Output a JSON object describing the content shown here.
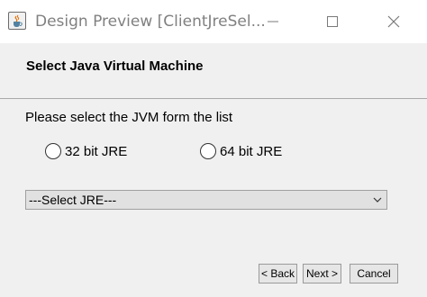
{
  "window": {
    "title": "Design Preview [ClientJreSel...",
    "app_icon": "java-cup-icon",
    "controls": [
      "minimize-icon",
      "maximize-icon",
      "close-icon"
    ]
  },
  "header": {
    "title": "Select Java Virtual Machine"
  },
  "content": {
    "prompt": "Please select the JVM form the list",
    "radios": [
      {
        "label": "32 bit JRE",
        "checked": false
      },
      {
        "label": "64 bit JRE",
        "checked": false
      }
    ],
    "select": {
      "value": "---Select JRE---"
    }
  },
  "buttons": {
    "back": "< Back",
    "next": "Next >",
    "cancel": "Cancel"
  }
}
